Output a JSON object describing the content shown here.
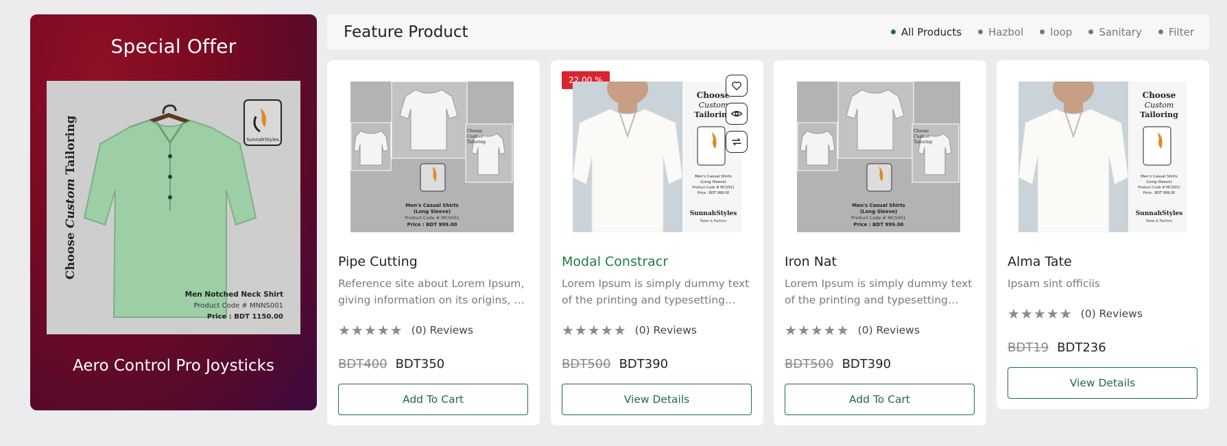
{
  "special_offer": {
    "title": "Special Offer",
    "product_name": "Aero Control Pro Joysticks",
    "image": {
      "brand": "SunnahStyles",
      "vertical_text_1": "Choose ",
      "vertical_text_2": "Custom",
      "vertical_text_3": " Tailoring",
      "shirt_name": "Men Notched Neck Shirt",
      "code": "Product Code # MNNS001",
      "price": "Price : BDT 1150.00"
    }
  },
  "feature": {
    "title": "Feature Product",
    "tabs": [
      {
        "label": "All Products",
        "active": true
      },
      {
        "label": "Hazbol",
        "active": false
      },
      {
        "label": "loop",
        "active": false
      },
      {
        "label": "Sanitary",
        "active": false
      },
      {
        "label": "Filter",
        "active": false
      }
    ]
  },
  "products": [
    {
      "name": "Pipe Cutting",
      "description": "Reference site about Lorem Ipsum, giving information on its origins, as well as a random Lipsum generator.",
      "rating_stars": "★★★★★",
      "reviews": "(0) Reviews",
      "old_price": "BDT400",
      "price": "BDT350",
      "button": "Add To Cart",
      "img": {
        "line1": "Men's Casual Shirts",
        "line2": "(Long Sleeve)",
        "line3": "Product Code # MCS001",
        "line4": "Price : BDT 999.00",
        "tag1": "Choose",
        "tag2": "Custom",
        "tag3": "Tailoring"
      }
    },
    {
      "name": "Modal Constracr",
      "description": "Lorem Ipsum is simply dummy text of the printing and typesetting industry. Lorem Ipsum has been the industry's standard.",
      "rating_stars": "★★★★★",
      "reviews": "(0) Reviews",
      "old_price": "BDT500",
      "price": "BDT390",
      "button": "View Details",
      "badge": "22.00 %",
      "img": {
        "head1": "Choose",
        "head2": "Custom",
        "head3": "Tailoring",
        "line1": "Men's Casual Shirts",
        "line2": "(Long Sleeve)",
        "line3": "Product Code # MCS001",
        "line4": "Price : BDT 999.00",
        "brand": "SunnahStyles",
        "brand_sub": "Taste & Fashion"
      }
    },
    {
      "name": "Iron Nat",
      "description": "Lorem Ipsum is simply dummy text of the printing and typesetting industry. Lorem Ipsum has been the industry's standard.",
      "rating_stars": "★★★★★",
      "reviews": "(0) Reviews",
      "old_price": "BDT500",
      "price": "BDT390",
      "button": "Add To Cart",
      "img": {
        "line1": "Men's Casual Shirts",
        "line2": "(Long Sleeve)",
        "line3": "Product Code # MCS001",
        "line4": "Price : BDT 999.00",
        "tag1": "Choose",
        "tag2": "Custom",
        "tag3": "Tailoring"
      }
    },
    {
      "name": "Alma Tate",
      "description": "Ipsam sint officiis",
      "rating_stars": "★★★★★",
      "reviews": "(0) Reviews",
      "old_price": "BDT19",
      "price": "BDT236",
      "button": "View Details",
      "img": {
        "head1": "Choose",
        "head2": "Custom",
        "head3": "Tailoring",
        "line1": "Men's Casual Shirts",
        "line2": "(Long Sleeve)",
        "line3": "Product Code # MCS001",
        "line4": "Price : BDT 999.00",
        "brand": "SunnahStyles",
        "brand_sub": "Taste & Fashion"
      }
    }
  ],
  "colors": {
    "accent_green": "#1f6b3e",
    "badge_red": "#d9252f",
    "offer_bg": "#7a0a22"
  }
}
